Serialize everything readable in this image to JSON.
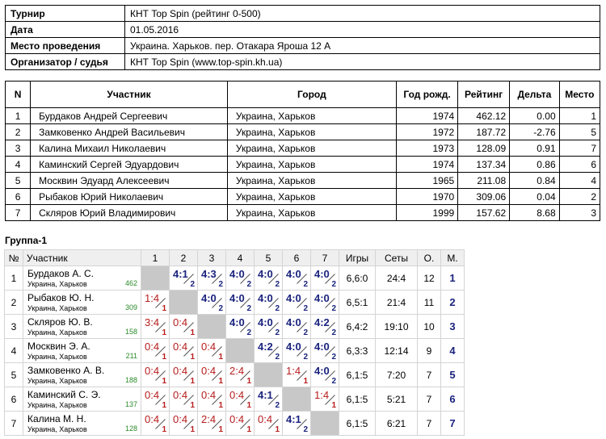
{
  "info": [
    {
      "label": "Турнир",
      "value": "КНТ Top Spin (рейтинг 0-500)"
    },
    {
      "label": "Дата",
      "value": "01.05.2016"
    },
    {
      "label": "Место проведения",
      "value": "Украина. Харьков. пер. Отакара Яроша 12 А"
    },
    {
      "label": "Организатор / судья",
      "value": "КНТ Top Spin (www.top-spin.kh.ua)"
    }
  ],
  "participants": {
    "headers": [
      "N",
      "Участник",
      "Город",
      "Год рожд.",
      "Рейтинг",
      "Дельта",
      "Место"
    ],
    "rows": [
      [
        "1",
        "Бурдаков Андрей Сергеевич",
        "Украина, Харьков",
        "1974",
        "462.12",
        "0.00",
        "1"
      ],
      [
        "2",
        "Замковенко Андрей Васильевич",
        "Украина, Харьков",
        "1972",
        "187.72",
        "-2.76",
        "5"
      ],
      [
        "3",
        "Калина Михаил Николаевич",
        "Украина, Харьков",
        "1973",
        "128.09",
        "0.91",
        "7"
      ],
      [
        "4",
        "Каминский Сергей Эдуардович",
        "Украина, Харьков",
        "1974",
        "137.34",
        "0.86",
        "6"
      ],
      [
        "5",
        "Москвин Эдуард Алексеевич",
        "Украина, Харьков",
        "1965",
        "211.08",
        "0.84",
        "4"
      ],
      [
        "6",
        "Рыбаков Юрий Николаевич",
        "Украина, Харьков",
        "1970",
        "309.06",
        "0.04",
        "2"
      ],
      [
        "7",
        "Скляров Юрий Владимирович",
        "Украина, Харьков",
        "1999",
        "157.62",
        "8.68",
        "3"
      ]
    ]
  },
  "group": {
    "title": "Группа-1",
    "headers": [
      "№",
      "Участник",
      "1",
      "2",
      "3",
      "4",
      "5",
      "6",
      "7",
      "Игры",
      "Сеты",
      "О.",
      "М."
    ],
    "rows": [
      {
        "n": "1",
        "name": "Бурдаков А. С.",
        "city": "Украина, Харьков",
        "rating": "462",
        "cells": [
          null,
          {
            "s": "4:1",
            "p": "2"
          },
          {
            "s": "4:3",
            "p": "2"
          },
          {
            "s": "4:0",
            "p": "2"
          },
          {
            "s": "4:0",
            "p": "2"
          },
          {
            "s": "4:0",
            "p": "2"
          },
          {
            "s": "4:0",
            "p": "2"
          }
        ],
        "games": "6,6:0",
        "sets": "24:4",
        "points": "12",
        "place": "1"
      },
      {
        "n": "2",
        "name": "Рыбаков Ю. Н.",
        "city": "Украина, Харьков",
        "rating": "309",
        "cells": [
          {
            "s": "1:4",
            "p": "1"
          },
          null,
          {
            "s": "4:0",
            "p": "2"
          },
          {
            "s": "4:0",
            "p": "2"
          },
          {
            "s": "4:0",
            "p": "2"
          },
          {
            "s": "4:0",
            "p": "2"
          },
          {
            "s": "4:0",
            "p": "2"
          }
        ],
        "games": "6,5:1",
        "sets": "21:4",
        "points": "11",
        "place": "2"
      },
      {
        "n": "3",
        "name": "Скляров Ю. В.",
        "city": "Украина, Харьков",
        "rating": "158",
        "cells": [
          {
            "s": "3:4",
            "p": "1"
          },
          {
            "s": "0:4",
            "p": "1"
          },
          null,
          {
            "s": "4:0",
            "p": "2"
          },
          {
            "s": "4:0",
            "p": "2"
          },
          {
            "s": "4:0",
            "p": "2"
          },
          {
            "s": "4:2",
            "p": "2"
          }
        ],
        "games": "6,4:2",
        "sets": "19:10",
        "points": "10",
        "place": "3"
      },
      {
        "n": "4",
        "name": "Москвин Э. А.",
        "city": "Украина, Харьков",
        "rating": "211",
        "cells": [
          {
            "s": "0:4",
            "p": "1"
          },
          {
            "s": "0:4",
            "p": "1"
          },
          {
            "s": "0:4",
            "p": "1"
          },
          null,
          {
            "s": "4:2",
            "p": "2"
          },
          {
            "s": "4:0",
            "p": "2"
          },
          {
            "s": "4:0",
            "p": "2"
          }
        ],
        "games": "6,3:3",
        "sets": "12:14",
        "points": "9",
        "place": "4"
      },
      {
        "n": "5",
        "name": "Замковенко А. В.",
        "city": "Украина, Харьков",
        "rating": "188",
        "cells": [
          {
            "s": "0:4",
            "p": "1"
          },
          {
            "s": "0:4",
            "p": "1"
          },
          {
            "s": "0:4",
            "p": "1"
          },
          {
            "s": "2:4",
            "p": "1"
          },
          null,
          {
            "s": "1:4",
            "p": "1"
          },
          {
            "s": "4:0",
            "p": "2"
          }
        ],
        "games": "6,1:5",
        "sets": "7:20",
        "points": "7",
        "place": "5"
      },
      {
        "n": "6",
        "name": "Каминский С. Э.",
        "city": "Украина, Харьков",
        "rating": "137",
        "cells": [
          {
            "s": "0:4",
            "p": "1"
          },
          {
            "s": "0:4",
            "p": "1"
          },
          {
            "s": "0:4",
            "p": "1"
          },
          {
            "s": "0:4",
            "p": "1"
          },
          {
            "s": "4:1",
            "p": "2"
          },
          null,
          {
            "s": "1:4",
            "p": "1"
          }
        ],
        "games": "6,1:5",
        "sets": "5:21",
        "points": "7",
        "place": "6"
      },
      {
        "n": "7",
        "name": "Калина М. Н.",
        "city": "Украина, Харьков",
        "rating": "128",
        "cells": [
          {
            "s": "0:4",
            "p": "1"
          },
          {
            "s": "0:4",
            "p": "1"
          },
          {
            "s": "2:4",
            "p": "1"
          },
          {
            "s": "0:4",
            "p": "1"
          },
          {
            "s": "0:4",
            "p": "1"
          },
          {
            "s": "4:1",
            "p": "2"
          },
          null
        ],
        "games": "6,1:5",
        "sets": "6:21",
        "points": "7",
        "place": "7"
      }
    ]
  }
}
